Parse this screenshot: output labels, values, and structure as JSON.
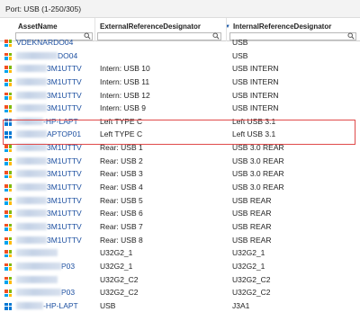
{
  "panel": {
    "title": "Port: USB (1-250/305)"
  },
  "columns": {
    "asset": "AssetName",
    "external": "ExternalReferenceDesignator",
    "internal": "InternalReferenceDesignator",
    "sort_indicator": "▼"
  },
  "highlight_color": "#e04a4a",
  "link_color": "#1c4fa0",
  "rows": [
    {
      "icon": "windows-xp-icon",
      "asset_visible": "VDEKNARDO04",
      "ext": "",
      "int": "USB"
    },
    {
      "icon": "windows-xp-icon",
      "asset_visible": "DO04",
      "ext": "",
      "int": "USB"
    },
    {
      "icon": "windows-xp-icon",
      "asset_visible": "3M1UTTV",
      "ext": "Intern: USB 10",
      "int": "USB INTERN"
    },
    {
      "icon": "windows-xp-icon",
      "asset_visible": "3M1UTTV",
      "ext": "Intern: USB 11",
      "int": "USB INTERN"
    },
    {
      "icon": "windows-xp-icon",
      "asset_visible": "3M1UTTV",
      "ext": "Intern: USB 12",
      "int": "USB INTERN"
    },
    {
      "icon": "windows-xp-icon",
      "asset_visible": "3M1UTTV",
      "ext": "Intern: USB 9",
      "int": "USB INTERN"
    },
    {
      "icon": "windows-10-icon",
      "asset_visible": "-HP-LAPT",
      "ext": "Left TYPE C",
      "int": "Left USB 3.1"
    },
    {
      "icon": "windows-10-icon",
      "asset_visible": "APTOP01",
      "ext": "Left TYPE C",
      "int": "Left USB 3.1"
    },
    {
      "icon": "windows-xp-icon",
      "asset_visible": "3M1UTTV",
      "ext": "Rear: USB 1",
      "int": "USB 3.0 REAR"
    },
    {
      "icon": "windows-xp-icon",
      "asset_visible": "3M1UTTV",
      "ext": "Rear: USB 2",
      "int": "USB 3.0 REAR"
    },
    {
      "icon": "windows-xp-icon",
      "asset_visible": "3M1UTTV",
      "ext": "Rear: USB 3",
      "int": "USB 3.0 REAR"
    },
    {
      "icon": "windows-xp-icon",
      "asset_visible": "3M1UTTV",
      "ext": "Rear: USB 4",
      "int": "USB 3.0 REAR"
    },
    {
      "icon": "windows-xp-icon",
      "asset_visible": "3M1UTTV",
      "ext": "Rear: USB 5",
      "int": "USB REAR"
    },
    {
      "icon": "windows-xp-icon",
      "asset_visible": "3M1UTTV",
      "ext": "Rear: USB 6",
      "int": "USB REAR"
    },
    {
      "icon": "windows-xp-icon",
      "asset_visible": "3M1UTTV",
      "ext": "Rear: USB 7",
      "int": "USB REAR"
    },
    {
      "icon": "windows-xp-icon",
      "asset_visible": "3M1UTTV",
      "ext": "Rear: USB 8",
      "int": "USB REAR"
    },
    {
      "icon": "windows-xp-icon",
      "asset_visible": "",
      "ext": "U32G2_1",
      "int": "U32G2_1"
    },
    {
      "icon": "windows-xp-icon",
      "asset_visible": "P03",
      "ext": "U32G2_1",
      "int": "U32G2_1"
    },
    {
      "icon": "windows-xp-icon",
      "asset_visible": "",
      "ext": "U32G2_C2",
      "int": "U32G2_C2"
    },
    {
      "icon": "windows-xp-icon",
      "asset_visible": "P03",
      "ext": "U32G2_C2",
      "int": "U32G2_C2"
    },
    {
      "icon": "windows-10-icon",
      "asset_visible": "-HP-LAPT",
      "ext": "USB",
      "int": "J3A1"
    }
  ]
}
